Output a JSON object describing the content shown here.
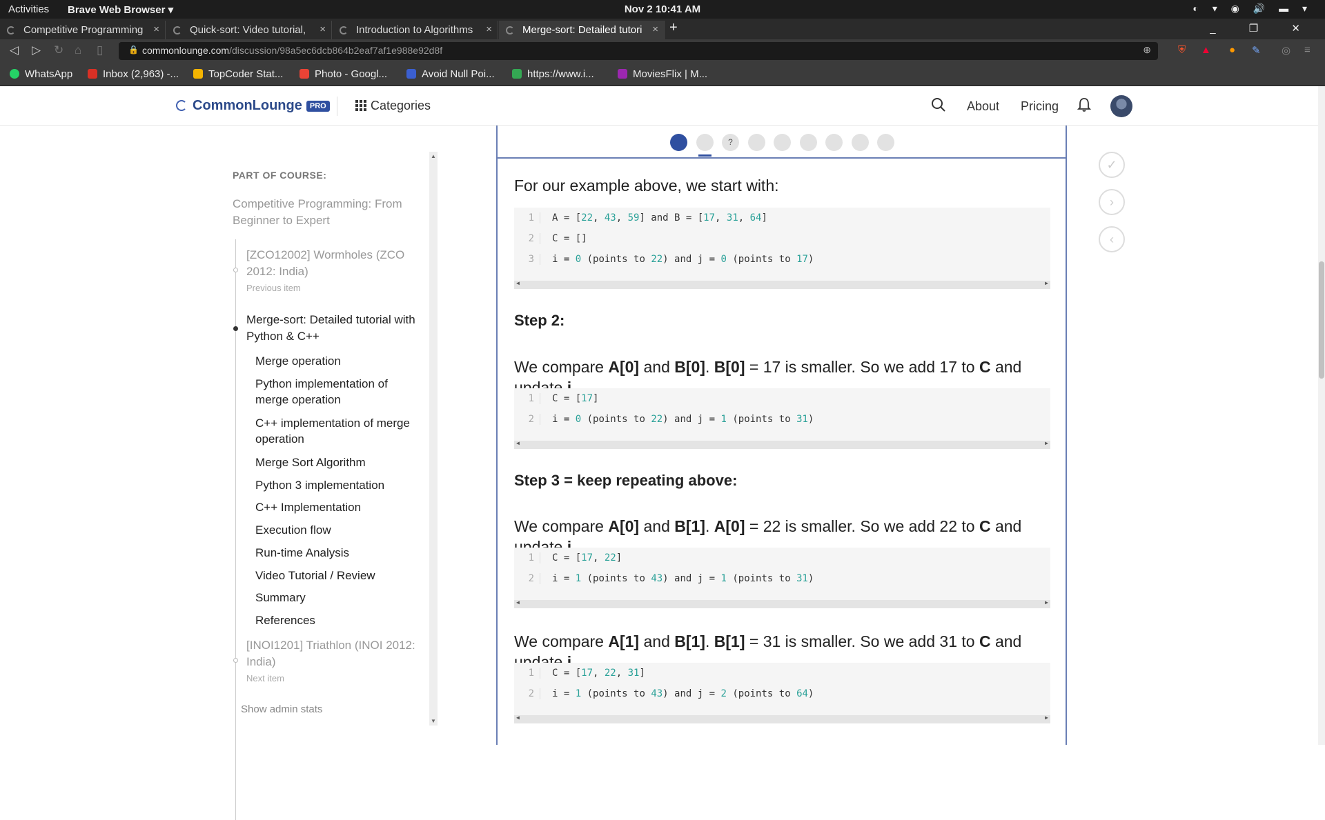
{
  "system": {
    "activities": "Activities",
    "browser_menu": "Brave Web Browser ▾",
    "clock": "Nov 2  10:41 AM"
  },
  "tabs": [
    {
      "label": "Competitive Programming"
    },
    {
      "label": "Quick-sort: Video tutorial,"
    },
    {
      "label": "Introduction to Algorithms"
    },
    {
      "label": "Merge-sort: Detailed tutori"
    }
  ],
  "address": {
    "host": "commonlounge.com",
    "path": "/discussion/98a5ec6dcb864b2eaf7af1e988e92d8f"
  },
  "bookmarks": [
    {
      "label": "WhatsApp",
      "color": "#25d366"
    },
    {
      "label": "Inbox (2,963) -...",
      "color": "#d93025"
    },
    {
      "label": "TopCoder Stat...",
      "color": "#f4b400"
    },
    {
      "label": "Photo - Googl...",
      "color": "#ea4335"
    },
    {
      "label": "Avoid Null Poi...",
      "color": "#3b5fd0"
    },
    {
      "label": "https://www.i...",
      "color": "#34a853"
    },
    {
      "label": "MoviesFlix | M...",
      "color": "#9c27b0"
    }
  ],
  "header": {
    "logo": "CommonLounge",
    "pro": "PRO",
    "categories": "Categories",
    "about": "About",
    "pricing": "Pricing"
  },
  "sidebar": {
    "part_of_course": "PART OF COURSE:",
    "course_title": "Competitive Programming: From Beginner to Expert",
    "prev_title": "[ZCO12002] Wormholes (ZCO 2012: India)",
    "prev_label": "Previous item",
    "current_title": "Merge-sort: Detailed tutorial with Python & C++",
    "toc": [
      "Merge operation",
      "Python implementation of merge operation",
      "C++ implementation of merge operation",
      "Merge Sort Algorithm",
      "Python 3 implementation",
      "C++ Implementation",
      "Execution flow",
      "Run-time Analysis",
      "Video Tutorial / Review",
      "Summary",
      "References"
    ],
    "next_title": "[INOI1201] Triathlon (INOI 2012: India)",
    "next_label": "Next item",
    "admin": "Show admin stats"
  },
  "progress": {
    "count": 9,
    "current": 1,
    "quiz_index": 3,
    "quiz_mark": "?"
  },
  "content": {
    "intro": "For our example above, we start with:",
    "code1": [
      "A = [22, 43, 59] and B = [17, 31, 64]",
      "C = []",
      "i = 0 (points to 22) and j = 0 (points to 17)"
    ],
    "step2": "Step 2:",
    "p2": {
      "a": "We compare ",
      "b1": "A[0]",
      "c": " and ",
      "b2": "B[0]",
      "d": ". ",
      "b3": "B[0]",
      "e": " = 17 is smaller. So we add 17 to ",
      "b4": "C",
      "f": " and update ",
      "b5": "j",
      "g": "."
    },
    "code2": [
      "C = [17]",
      "i = 0 (points to 22) and j = 1 (points to 31)"
    ],
    "step3": "Step 3 = keep repeating above:",
    "p3": {
      "a": "We compare ",
      "b1": "A[0]",
      "c": " and ",
      "b2": "B[1]",
      "d": ". ",
      "b3": "A[0]",
      "e": " = 22 is smaller. So we add 22 to ",
      "b4": "C",
      "f": " and update ",
      "b5": "i",
      "g": "."
    },
    "code3": [
      "C = [17, 22]",
      "i = 1 (points to 43) and j = 1 (points to 31)"
    ],
    "p4": {
      "a": "We compare ",
      "b1": "A[1]",
      "c": " and ",
      "b2": "B[1]",
      "d": ". ",
      "b3": "B[1]",
      "e": " = 31 is smaller. So we add 31 to ",
      "b4": "C",
      "f": " and update ",
      "b5": "j",
      "g": "."
    },
    "code4": [
      "C = [17, 22, 31]",
      "i = 1 (points to 43) and j = 2 (points to 64)"
    ]
  },
  "colors": {
    "accent": "#2f4fa0",
    "code_number": "#2aa198"
  }
}
